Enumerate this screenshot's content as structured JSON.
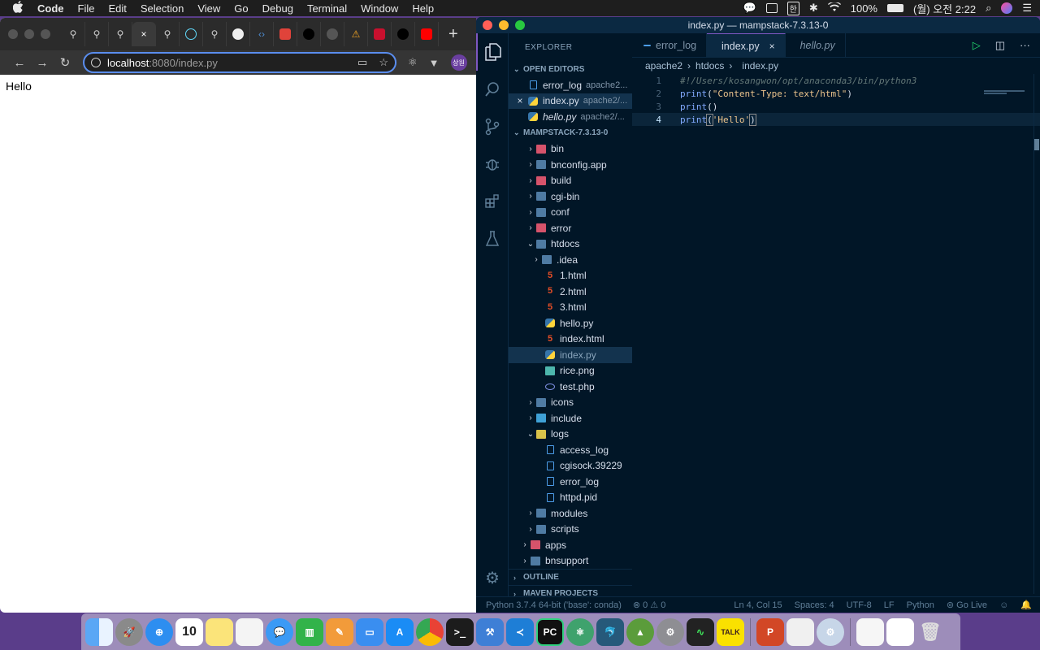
{
  "menubar": {
    "items": [
      "Code",
      "File",
      "Edit",
      "Selection",
      "View",
      "Go",
      "Debug",
      "Terminal",
      "Window",
      "Help"
    ],
    "battery": "100%",
    "clock": "(월) 오전 2:22",
    "ime": "한"
  },
  "browser": {
    "url_host": "localhost",
    "url_path": ":8080/index.py",
    "page_text": "Hello",
    "profile": "상원",
    "tab_close": "×",
    "new_tab": "+"
  },
  "vscode": {
    "title": "index.py — mampstack-7.3.13-0",
    "explorer_title": "EXPLORER",
    "open_editors_title": "OPEN EDITORS",
    "open_editors": [
      {
        "name": "error_log",
        "desc": "apache2..."
      },
      {
        "name": "index.py",
        "desc": "apache2/..."
      },
      {
        "name": "hello.py",
        "desc": "apache2/..."
      }
    ],
    "workspace_title": "MAMPSTACK-7.3.13-0",
    "tree": {
      "bin": "bin",
      "bnconfig": "bnconfig.app",
      "build": "build",
      "cgibin": "cgi-bin",
      "conf": "conf",
      "error": "error",
      "htdocs": "htdocs",
      "idea": ".idea",
      "html1": "1.html",
      "html2": "2.html",
      "html3": "3.html",
      "hellopy": "hello.py",
      "indexhtml": "index.html",
      "indexpy": "index.py",
      "rice": "rice.png",
      "testphp": "test.php",
      "icons": "icons",
      "include": "include",
      "logs": "logs",
      "access_log": "access_log",
      "cgisock": "cgisock.39229",
      "error_log": "error_log",
      "httpd": "httpd.pid",
      "modules": "modules",
      "scripts": "scripts",
      "apps": "apps",
      "bnsupport": "bnsupport"
    },
    "outline_title": "OUTLINE",
    "maven_title": "MAVEN PROJECTS",
    "tabs": [
      {
        "label": "error_log"
      },
      {
        "label": "index.py"
      },
      {
        "label": "hello.py"
      }
    ],
    "breadcrumb": [
      "apache2",
      "htdocs",
      "index.py"
    ],
    "code": {
      "l1": "#!/Users/kosangwon/opt/anaconda3/bin/python3",
      "l2_fn": "print",
      "l2_str": "\"Content-Type: text/html\"",
      "l3_fn": "print",
      "l4_fn": "print",
      "l4_str": "'Hello'"
    },
    "line_numbers": [
      "1",
      "2",
      "3",
      "4"
    ],
    "status": {
      "interpreter": "Python 3.7.4 64-bit ('base': conda)",
      "problems": "⊗ 0 ⚠ 0",
      "position": "Ln 4, Col 15",
      "spaces": "Spaces: 4",
      "encoding": "UTF-8",
      "eol": "LF",
      "language": "Python",
      "golive": "Go Live"
    }
  },
  "dock": {
    "calendar_day": "10",
    "kakao": "TALK",
    "pycharm": "PC"
  },
  "colors": {
    "vscode_bg": "#011627",
    "accent": "#7e57c2",
    "omnibox_focus": "#5a8dee"
  }
}
